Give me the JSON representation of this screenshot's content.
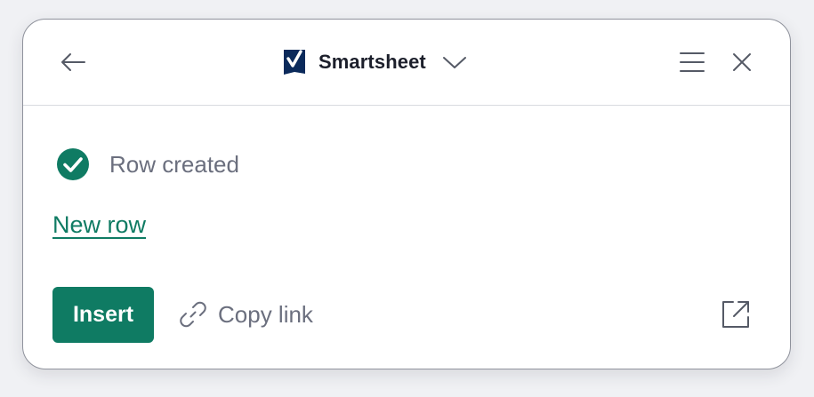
{
  "header": {
    "back_icon": "arrow-left-icon",
    "app_name": "Smartsheet",
    "app_logo_icon": "smartsheet-logo-icon",
    "switcher_icon": "chevron-down-icon",
    "menu_icon": "hamburger-menu-icon",
    "close_icon": "close-icon"
  },
  "status": {
    "icon": "check-circle-icon",
    "text": "Row created"
  },
  "result_link": {
    "label": "New row"
  },
  "actions": {
    "insert_label": "Insert",
    "copy_link_icon": "link-icon",
    "copy_link_label": "Copy link",
    "open_external_icon": "external-link-icon"
  },
  "colors": {
    "accent": "#0f7b63",
    "text_muted": "#6b6f7e",
    "text_strong": "#1c1f2b",
    "logo_blue": "#0b2a5b",
    "divider": "#d9dbe0"
  }
}
